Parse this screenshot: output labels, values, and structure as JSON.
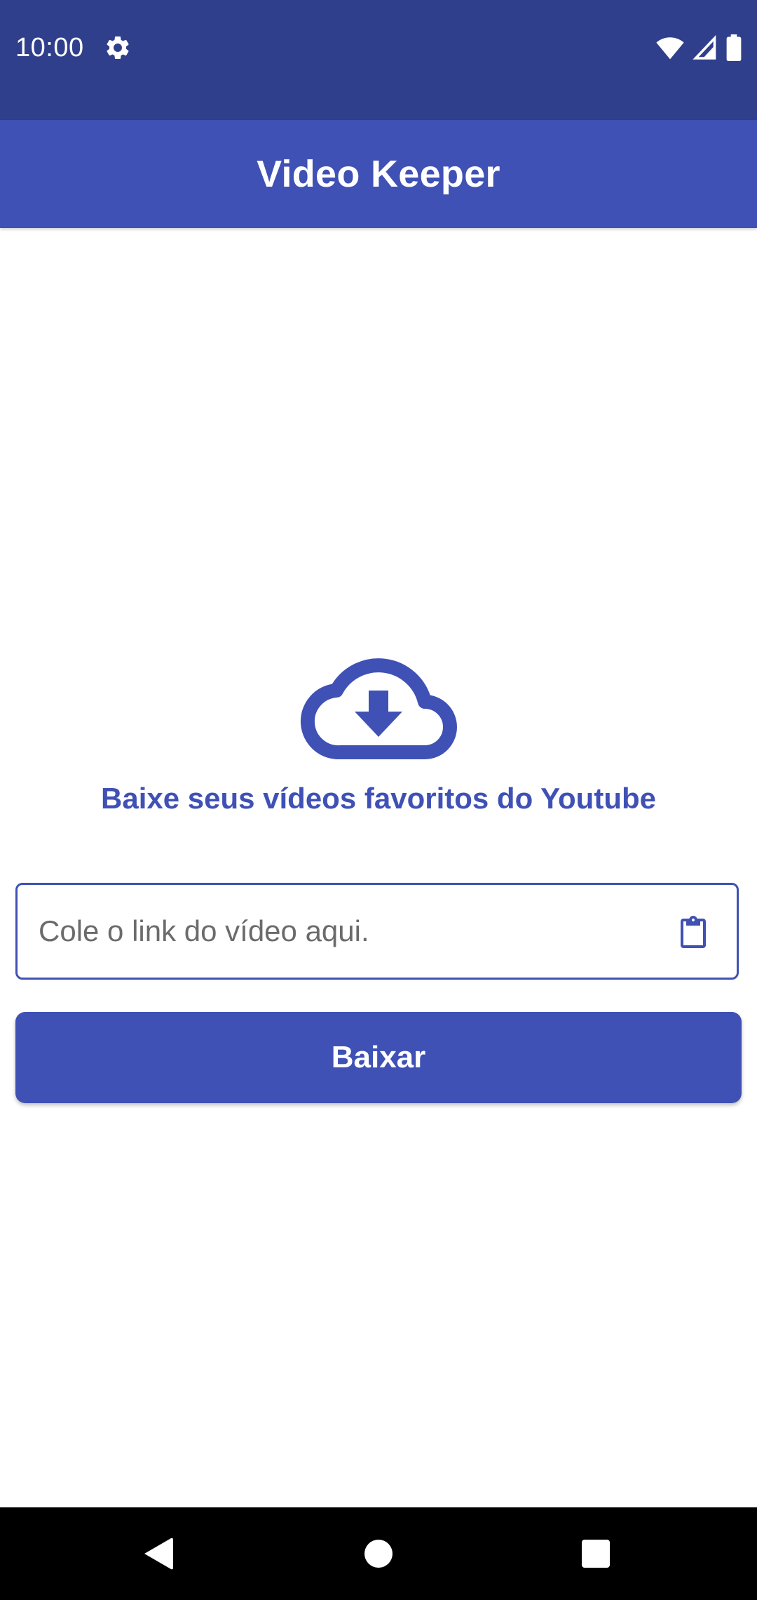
{
  "status_bar": {
    "time": "10:00",
    "icons": [
      "gear-icon",
      "wifi-icon",
      "signal-icon",
      "battery-icon"
    ]
  },
  "app_bar": {
    "title": "Video Keeper"
  },
  "hero": {
    "icon": "cloud-download-icon",
    "tagline": "Baixe seus vídeos favoritos do Youtube"
  },
  "link_field": {
    "value": "",
    "placeholder": "Cole o link do vídeo aqui.",
    "trailing_icon": "clipboard-icon"
  },
  "download_button": {
    "label": "Baixar"
  },
  "nav_bar": {
    "icons": [
      "back-icon",
      "home-icon",
      "recents-icon"
    ]
  },
  "colors": {
    "status_bar": "#303F8C",
    "primary": "#3F51B5",
    "nav_bar": "#000000",
    "background": "#FFFFFF"
  }
}
